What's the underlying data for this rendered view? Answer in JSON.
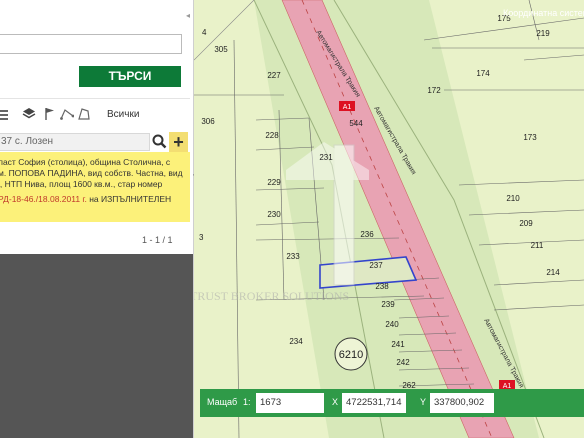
{
  "search": {
    "button_label": "ТЪРСИ"
  },
  "toolbar": {
    "all_label": "Всички"
  },
  "result": {
    "input_value": "37 с. Лозен",
    "info_lines": [
      "ласт София (столица), община Столична, с",
      "м. ПОПОВА ПАДИНА, вид собств. Частна, вид",
      "i, НТП Нива, площ 1600 кв.м., стар номер"
    ],
    "order_ref": "РД-18-46./18.08.2011 г.",
    "order_suffix": " на ИЗПЪЛНИТЕЛЕН",
    "pager": "1 - 1 / 1"
  },
  "map": {
    "parcels": [
      "305",
      "306",
      "227",
      "228",
      "229",
      "230",
      "231",
      "233",
      "234",
      "236",
      "237",
      "238",
      "239",
      "240",
      "241",
      "242",
      "262",
      "544",
      "172",
      "173",
      "174",
      "175",
      "219",
      "210",
      "209",
      "211",
      "214"
    ],
    "block_number": "6210",
    "road_labels": [
      "Автомагистрала Тракия",
      "Автомагистрала Тракия",
      "Автомагистрала Тракия"
    ],
    "route_badges": [
      "А1",
      "А1"
    ],
    "watermark": "TRUST BROKER SOLUTIONS",
    "digit_labels": [
      "4",
      "3"
    ]
  },
  "bottom": {
    "scale_label": "Мащаб",
    "scale_prefix": "1:",
    "scale_value": "1673",
    "x_label": "X",
    "x_value": "4722531,714",
    "y_label": "Y",
    "y_value": "337800,902",
    "coord_label": "Координатна систем"
  },
  "colors": {
    "accent": "#0d7a38",
    "info_bg": "#fcf17a",
    "road": "#e58aa0",
    "map_bg": "#e9f2c9",
    "selected_parcel": "#3344cc"
  }
}
